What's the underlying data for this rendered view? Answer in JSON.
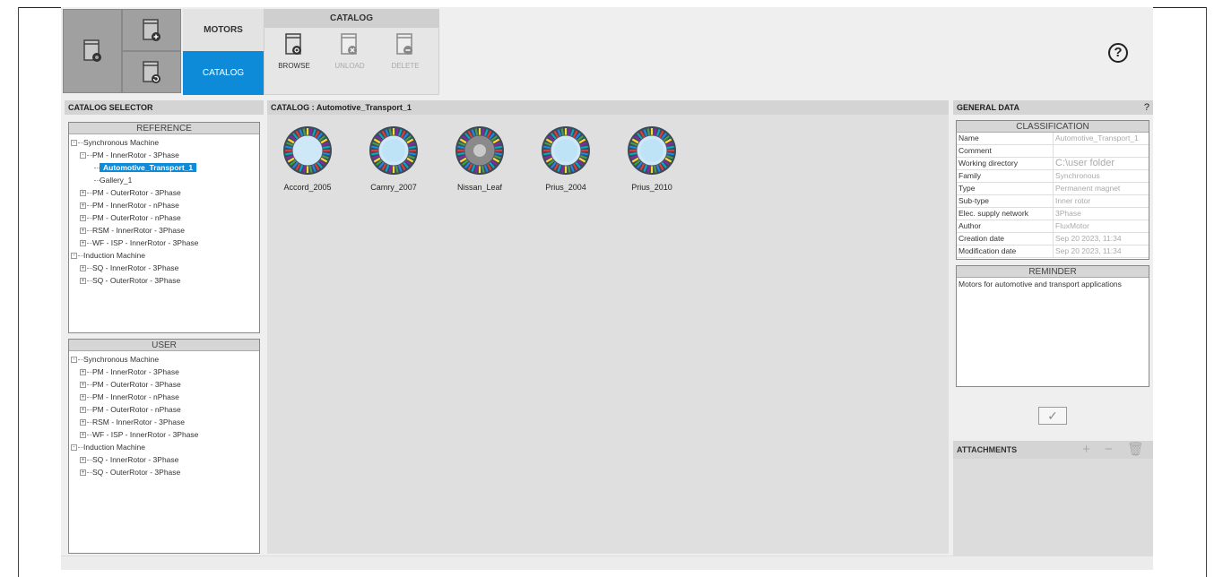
{
  "launcher": {
    "mode_motors": "MOTORS",
    "mode_catalog": "CATALOG"
  },
  "catalog_toolbar": {
    "title": "CATALOG",
    "browse": "BROWSE",
    "unload": "UNLOAD",
    "delete": "DELETE"
  },
  "help": {
    "symbol": "?"
  },
  "catalog_selector": {
    "title": "CATALOG SELECTOR",
    "reference_header": "REFERENCE",
    "user_header": "USER",
    "reference_tree": [
      "Synchronous Machine",
      "PM - InnerRotor - 3Phase",
      "Automotive_Transport_1",
      "Gallery_1",
      "PM - OuterRotor - 3Phase",
      "PM - InnerRotor - nPhase",
      "PM - OuterRotor - nPhase",
      "RSM - InnerRotor - 3Phase",
      "WF - ISP - InnerRotor - 3Phase",
      "Induction Machine",
      "SQ - InnerRotor - 3Phase",
      "SQ - OuterRotor - 3Phase"
    ],
    "user_tree": [
      "Synchronous Machine",
      "PM - InnerRotor - 3Phase",
      "PM - OuterRotor - 3Phase",
      "PM - InnerRotor - nPhase",
      "PM - OuterRotor - nPhase",
      "RSM - InnerRotor - 3Phase",
      "WF - ISP - InnerRotor - 3Phase",
      "Induction Machine",
      "SQ - InnerRotor - 3Phase",
      "SQ - OuterRotor - 3Phase"
    ]
  },
  "catalog": {
    "title": "CATALOG : Automotive_Transport_1",
    "motors": [
      "Accord_2005",
      "Camry_2007",
      "Nissan_Leaf",
      "Prius_2004",
      "Prius_2010"
    ]
  },
  "general_data": {
    "title": "GENERAL DATA",
    "help": "?",
    "classification_header": "CLASSIFICATION",
    "rows": [
      {
        "key": "Name",
        "value": "Automotive_Transport_1"
      },
      {
        "key": "Comment",
        "value": ""
      },
      {
        "key": "Working directory",
        "value": "C:\\user folder"
      },
      {
        "key": "Family",
        "value": "Synchronous"
      },
      {
        "key": "Type",
        "value": "Permanent magnet"
      },
      {
        "key": "Sub-type",
        "value": "Inner rotor"
      },
      {
        "key": "Elec. supply network",
        "value": "3Phase"
      },
      {
        "key": "Author",
        "value": "FluxMotor"
      },
      {
        "key": "Creation date",
        "value": "Sep 20 2023, 11:34"
      },
      {
        "key": "Modification date",
        "value": "Sep 20 2023, 11:34"
      }
    ],
    "reminder_header": "REMINDER",
    "reminder_text": "Motors for automotive and transport applications",
    "validate_symbol": "✓"
  },
  "attachments": {
    "title": "ATTACHMENTS",
    "tools": "+ − 🗑"
  },
  "colors": {
    "accent": "#0e8bd8",
    "panel_header": "#d4d4d4",
    "launcher_gray": "#a0a0a0"
  }
}
